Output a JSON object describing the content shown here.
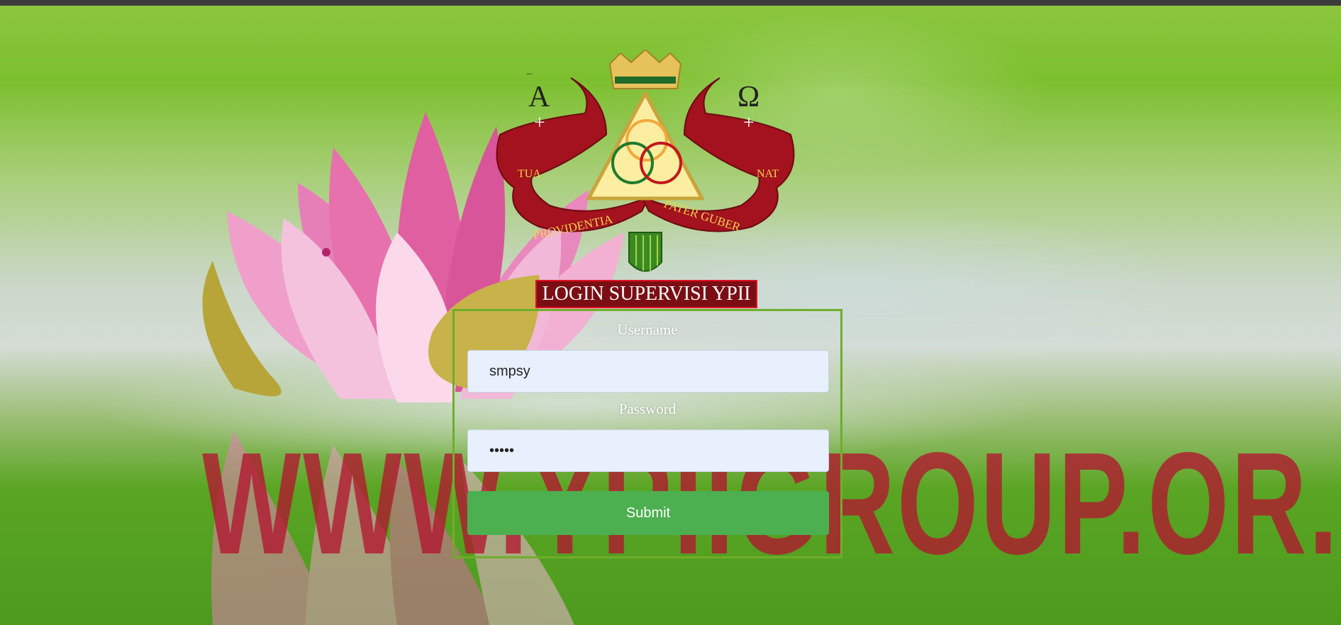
{
  "logo": {
    "symbol_left": "A",
    "symbol_right": "Ω",
    "motto": [
      "TUA",
      "PROVIDENTIA",
      "PATER GUBER",
      "NAT"
    ]
  },
  "watermark": "WWW.YPIIGROUP.OR.ID",
  "login": {
    "title": "LOGIN SUPERVISI YPII",
    "username_label": "Username",
    "username_value": "smpsy",
    "password_label": "Password",
    "password_value": "•••••",
    "submit_label": "Submit"
  },
  "colors": {
    "title_background": "#7a0e14",
    "submit_background": "#4caf50",
    "form_border": "#6fae2a",
    "watermark": "#b21630"
  }
}
